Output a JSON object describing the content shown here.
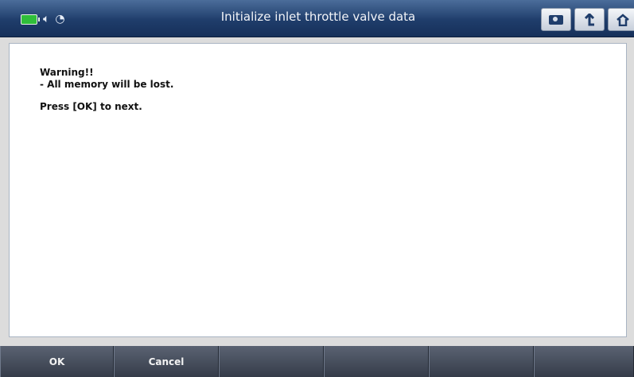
{
  "title_bar": {
    "title": "Initialize inlet throttle valve data",
    "status_icons": [
      "battery-icon",
      "speaker-icon",
      "wifi-icon"
    ],
    "buttons": [
      "camera-icon",
      "back-arrow-icon",
      "home-icon"
    ]
  },
  "message": {
    "line1": "Warning!!",
    "line2": "- All memory will be lost.",
    "line3": "Press [OK] to next."
  },
  "function_bar": {
    "buttons": [
      "OK",
      "Cancel",
      "",
      "",
      "",
      ""
    ]
  },
  "colors": {
    "titlebar": "#1f3d6b",
    "battery": "#2fbf3a",
    "bottombar": "#3f4654"
  }
}
